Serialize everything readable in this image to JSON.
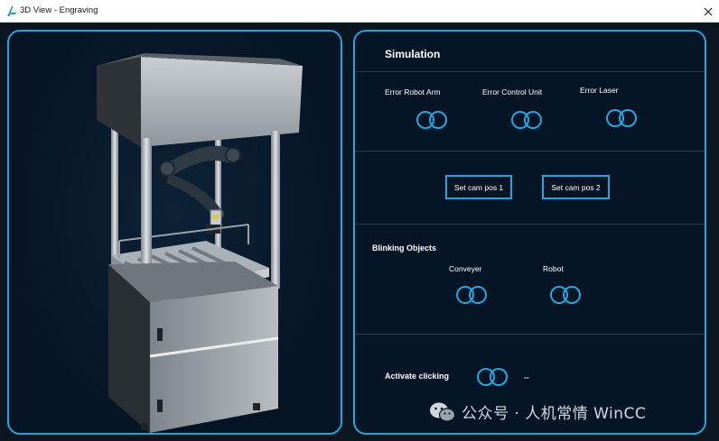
{
  "window": {
    "title": "3D View - Engraving",
    "close_symbol": "✕"
  },
  "controls": {
    "simulation_title": "Simulation",
    "error_toggles": [
      {
        "label": "Error Robot Arm",
        "state": "off"
      },
      {
        "label": "Error Control Unit",
        "state": "off"
      },
      {
        "label": "Error Laser",
        "state": "off"
      }
    ],
    "buttons": {
      "cam1": "Set cam pos 1",
      "cam2": "Set cam pos 2"
    },
    "blinking": {
      "title": "Blinking Objects",
      "items": [
        {
          "label": "Conveyer",
          "state": "off"
        },
        {
          "label": "Robot",
          "state": "off"
        }
      ]
    },
    "activate": {
      "label": "Activate clicking",
      "value": "--"
    }
  },
  "watermark": {
    "text": "公众号 · 人机常情 WinCC"
  },
  "colors": {
    "accent": "#1da6e0",
    "background": "#061526"
  }
}
